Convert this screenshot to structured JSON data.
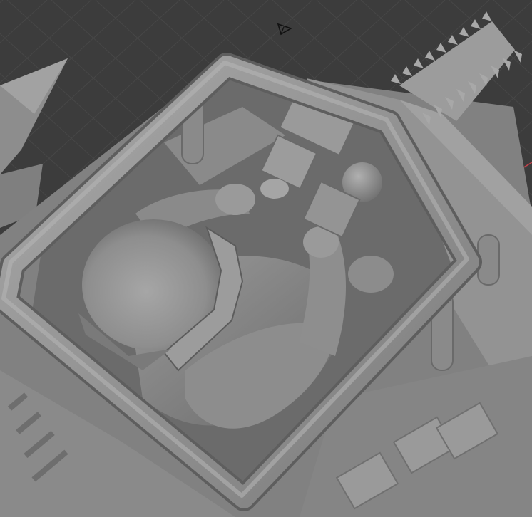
{
  "viewport": {
    "background_color": "#3c3c3c",
    "grid_color": "#474747",
    "axis_x_color": "#c8404a",
    "model_base_color": "#8c8c8c",
    "model_light_color": "#b3b3b3",
    "model_shadow_color": "#5a5a5a"
  },
  "icons": {
    "camera": "camera-gizmo-icon"
  }
}
